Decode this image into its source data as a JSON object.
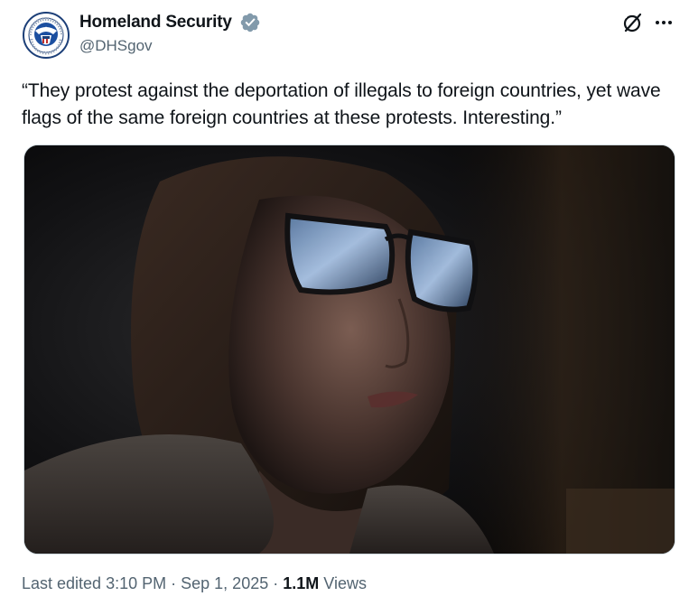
{
  "post": {
    "author": {
      "display_name": "Homeland Security",
      "handle": "@DHSgov",
      "verified": true,
      "avatar_icon": "dhs-seal-icon",
      "badge_color": "#829aab"
    },
    "text": "“They protest against the deportation of illegals to foreign countries, yet wave flags of the same foreign countries at these protests. Interesting.”",
    "footer": {
      "edited_prefix": "Last edited",
      "time": "3:10 PM",
      "separator": " · ",
      "date": "Sep 1, 2025",
      "views_count": "1.1M",
      "views_label": "Views"
    }
  },
  "header_actions": {
    "grok_icon": "grok-icon",
    "more_icon": "more-icon"
  },
  "colors": {
    "text_primary": "#0f1419",
    "text_secondary": "#536471",
    "border": "#cfd9de"
  }
}
